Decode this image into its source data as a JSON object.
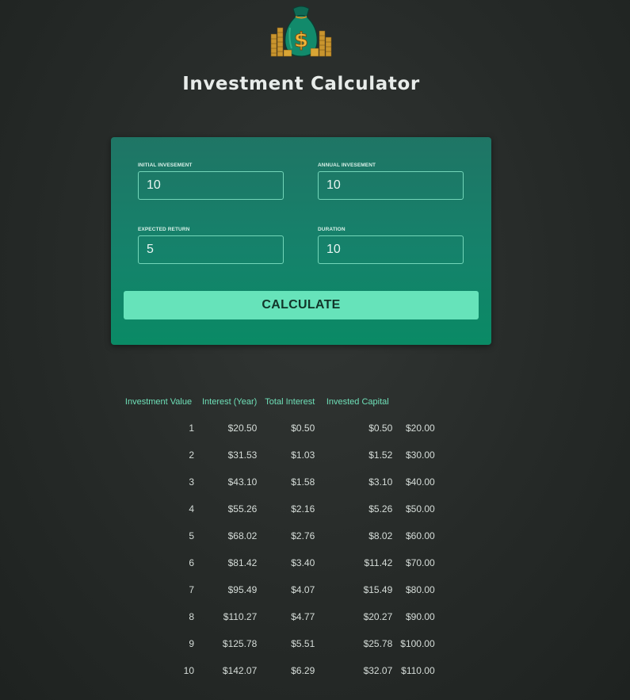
{
  "header": {
    "logo_icon": "money-bag-dollar-icon",
    "title": "Investment Calculator"
  },
  "form": {
    "initial_investment": {
      "label": "Initial Invesement",
      "value": "10"
    },
    "annual_investment": {
      "label": "Annual Invesement",
      "value": "10"
    },
    "expected_return": {
      "label": "Expected Return",
      "value": "5"
    },
    "duration": {
      "label": "Duration",
      "value": "10"
    },
    "calculate_label": "CALCULATE"
  },
  "results": {
    "headers": [
      "Investment Value",
      "Interest (Year)",
      "Total Interest",
      "Invested Capital",
      ""
    ],
    "rows": [
      [
        "1",
        "$20.50",
        "$0.50",
        "$0.50",
        "$20.00"
      ],
      [
        "2",
        "$31.53",
        "$1.03",
        "$1.52",
        "$30.00"
      ],
      [
        "3",
        "$43.10",
        "$1.58",
        "$3.10",
        "$40.00"
      ],
      [
        "4",
        "$55.26",
        "$2.16",
        "$5.26",
        "$50.00"
      ],
      [
        "5",
        "$68.02",
        "$2.76",
        "$8.02",
        "$60.00"
      ],
      [
        "6",
        "$81.42",
        "$3.40",
        "$11.42",
        "$70.00"
      ],
      [
        "7",
        "$95.49",
        "$4.07",
        "$15.49",
        "$80.00"
      ],
      [
        "8",
        "$110.27",
        "$4.77",
        "$20.27",
        "$90.00"
      ],
      [
        "9",
        "$125.78",
        "$5.51",
        "$25.78",
        "$100.00"
      ],
      [
        "10",
        "$142.07",
        "$6.29",
        "$32.07",
        "$110.00"
      ]
    ]
  },
  "colors": {
    "accent": "#66e3ba",
    "card_top": "#1f7565",
    "card_bottom": "#0a8a65",
    "header_text": "#6fe0b8",
    "background": "#2a2e2c"
  }
}
